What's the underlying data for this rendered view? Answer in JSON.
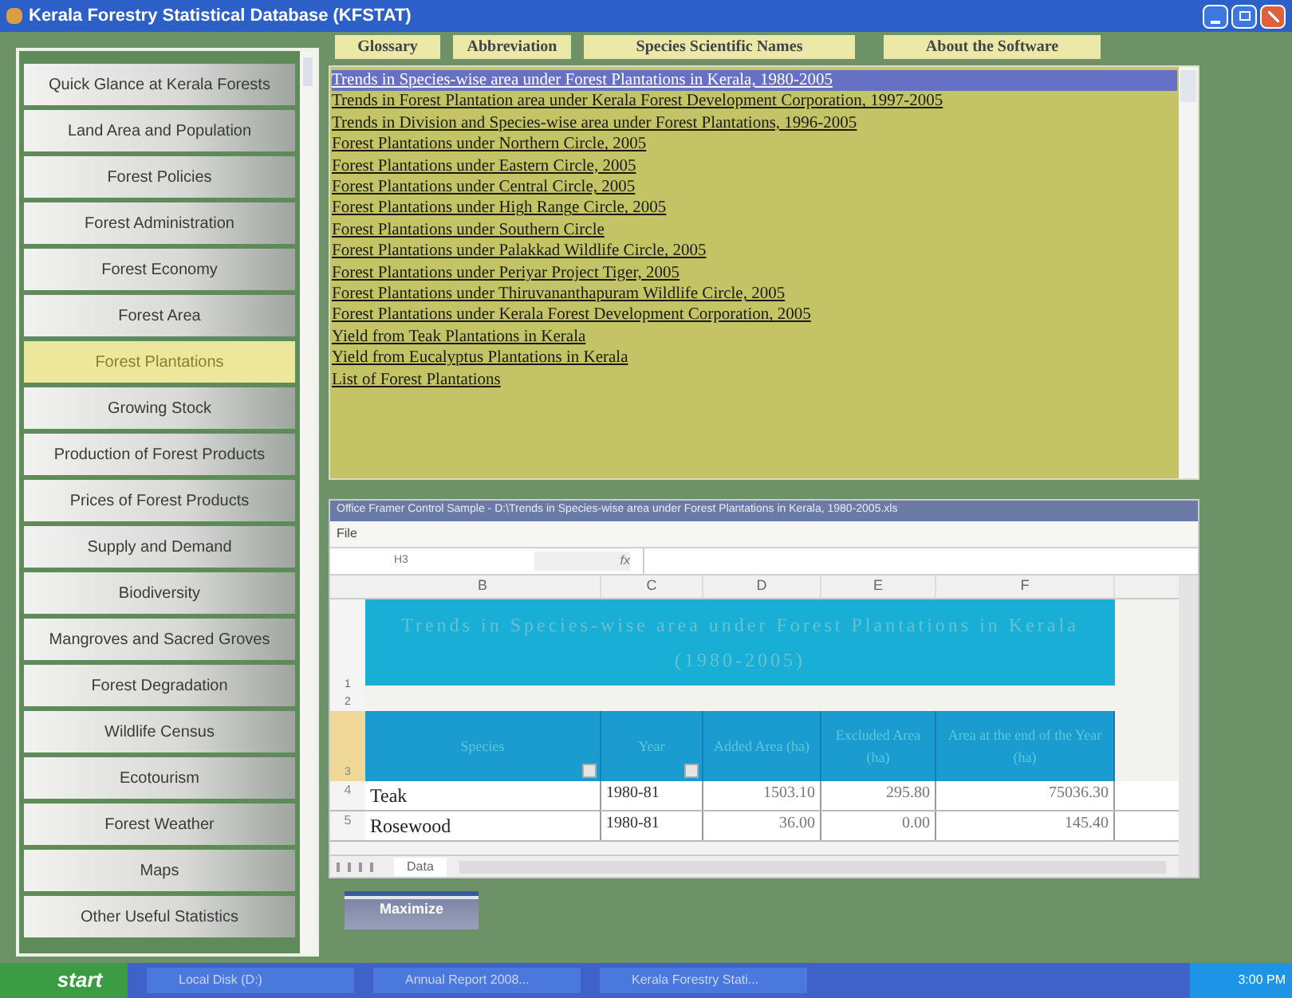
{
  "window": {
    "title": "Kerala Forestry  Statistical Database (KFSTAT)"
  },
  "top_buttons": [
    "Glossary",
    "Abbreviation",
    "Species Scientific Names",
    "About the Software"
  ],
  "sidebar": {
    "items": [
      {
        "label": "Quick Glance at Kerala Forests",
        "selected": false
      },
      {
        "label": "Land Area and  Population",
        "selected": false
      },
      {
        "label": "Forest Policies",
        "selected": false
      },
      {
        "label": "Forest Administration",
        "selected": false
      },
      {
        "label": "Forest Economy",
        "selected": false
      },
      {
        "label": "Forest Area",
        "selected": false
      },
      {
        "label": "Forest Plantations",
        "selected": true
      },
      {
        "label": "Growing Stock",
        "selected": false
      },
      {
        "label": "Production of Forest Products",
        "selected": false
      },
      {
        "label": "Prices of Forest Products",
        "selected": false
      },
      {
        "label": "Supply and Demand",
        "selected": false
      },
      {
        "label": "Biodiversity",
        "selected": false
      },
      {
        "label": "Mangroves and Sacred Groves",
        "selected": false
      },
      {
        "label": "Forest Degradation",
        "selected": false
      },
      {
        "label": "Wildlife Census",
        "selected": false
      },
      {
        "label": "Ecotourism",
        "selected": false
      },
      {
        "label": "Forest Weather",
        "selected": false
      },
      {
        "label": "Maps",
        "selected": false
      },
      {
        "label": "Other Useful Statistics",
        "selected": false
      }
    ]
  },
  "reports": [
    {
      "label": "Trends in Species-wise area under Forest Plantations in Kerala, 1980-2005",
      "selected": true
    },
    {
      "label": "Trends in Forest Plantation area under Kerala Forest Development Corporation, 1997-2005",
      "selected": false
    },
    {
      "label": "Trends in Division and Species-wise area under Forest Plantations, 1996-2005",
      "selected": false
    },
    {
      "label": "Forest Plantations under Northern Circle, 2005",
      "selected": false
    },
    {
      "label": "Forest Plantations under Eastern Circle, 2005",
      "selected": false
    },
    {
      "label": "Forest Plantations under Central Circle, 2005",
      "selected": false
    },
    {
      "label": "Forest Plantations under High Range Circle, 2005",
      "selected": false
    },
    {
      "label": "Forest Plantations under Southern Circle",
      "selected": false
    },
    {
      "label": "Forest Plantations under Palakkad Wildlife Circle, 2005",
      "selected": false
    },
    {
      "label": "Forest Plantations under Periyar Project Tiger, 2005",
      "selected": false
    },
    {
      "label": "Forest Plantations under Thiruvananthapuram Wildlife Circle, 2005",
      "selected": false
    },
    {
      "label": "Forest Plantations under Kerala Forest Development Corporation, 2005",
      "selected": false
    },
    {
      "label": "Yield from Teak Plantations in Kerala",
      "selected": false
    },
    {
      "label": "Yield from Eucalyptus Plantations in Kerala",
      "selected": false
    },
    {
      "label": "List of Forest Plantations",
      "selected": false
    }
  ],
  "spreadsheet": {
    "title": "Office Framer Control Sample - D:\\Trends in Species-wise area under Forest Plantations in Kerala, 1980-2005.xls",
    "menu": [
      "File"
    ],
    "cell_ref": "H3",
    "fx": "fx",
    "columns": [
      "B",
      "C",
      "D",
      "E",
      "F"
    ],
    "sheet_title": "Trends in Species-wise area under Forest Plantations in Kerala (1980-2005)",
    "title_row_numbers": [
      "1",
      "2"
    ],
    "header_row_number": "3",
    "headers": [
      "Species",
      "Year",
      "Added Area (ha)",
      "Excluded Area (ha)",
      "Area at the end of the Year (ha)"
    ],
    "rows": [
      {
        "num": "4",
        "cells": [
          "Teak",
          "1980-81",
          "1503.10",
          "295.80",
          "75036.30"
        ]
      },
      {
        "num": "5",
        "cells": [
          "Rosewood",
          "1980-81",
          "36.00",
          "0.00",
          "145.40"
        ]
      }
    ],
    "sheet_tabs": [
      "Data"
    ]
  },
  "maximize_button": "Maximize",
  "taskbar": {
    "start": "start",
    "tasks": [
      "Local Disk (D:)",
      "Annual Report 2008...",
      "Kerala Forestry Stati..."
    ],
    "clock": "3:00 PM"
  }
}
